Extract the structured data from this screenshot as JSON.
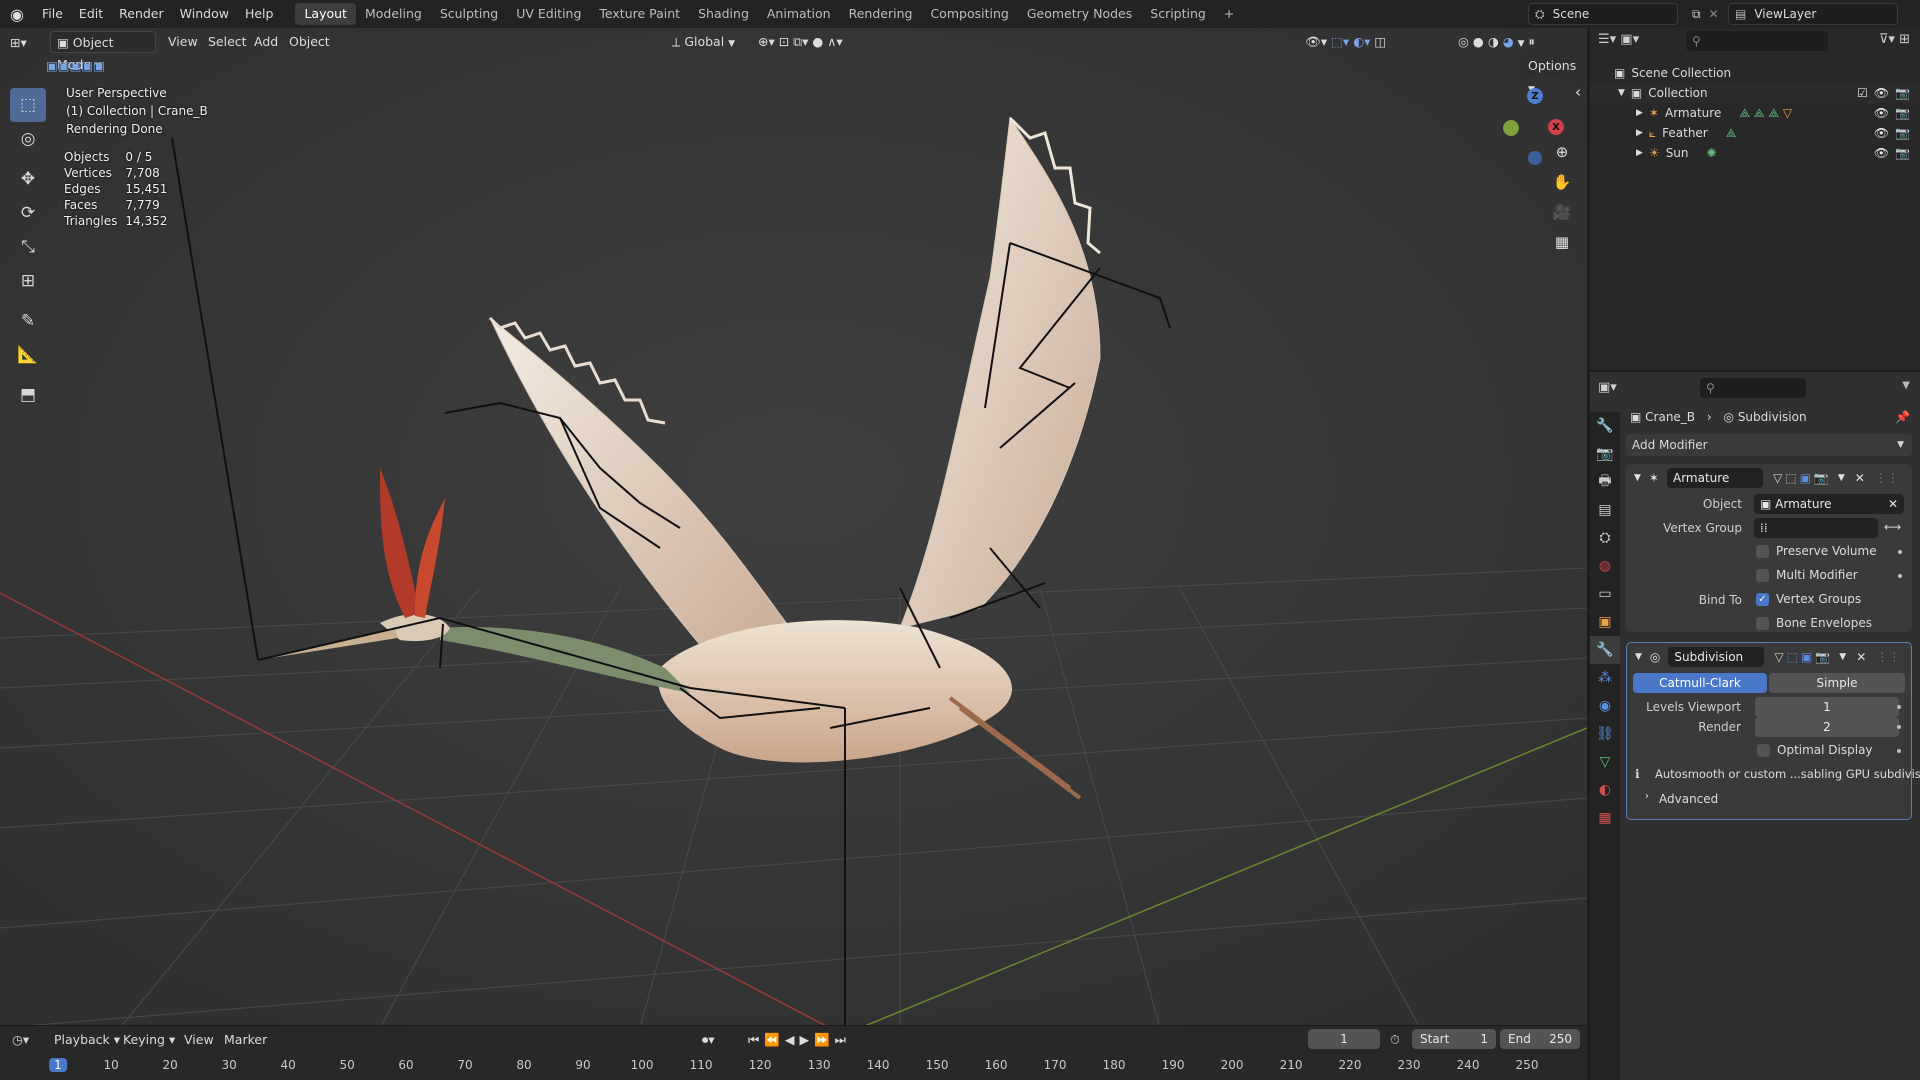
{
  "menu": {
    "items": [
      "File",
      "Edit",
      "Render",
      "Window",
      "Help"
    ],
    "workspaces": [
      "Layout",
      "Modeling",
      "Sculpting",
      "UV Editing",
      "Texture Paint",
      "Shading",
      "Animation",
      "Rendering",
      "Compositing",
      "Geometry Nodes",
      "Scripting"
    ],
    "active_workspace": "Layout",
    "add_tab": "+"
  },
  "scene": {
    "name": "Scene",
    "view_layer": "ViewLayer"
  },
  "viewport_header": {
    "mode": "Object Mode",
    "menus": [
      "View",
      "Select",
      "Add",
      "Object"
    ],
    "orientation": "Global",
    "options": "Options"
  },
  "overlay": {
    "perspective": "User Perspective",
    "collection_line": "(1) Collection | Crane_B",
    "render_status": "Rendering Done",
    "stats": [
      {
        "label": "Objects",
        "value": "0 / 5"
      },
      {
        "label": "Vertices",
        "value": "7,708"
      },
      {
        "label": "Edges",
        "value": "15,451"
      },
      {
        "label": "Faces",
        "value": "7,779"
      },
      {
        "label": "Triangles",
        "value": "14,352"
      }
    ]
  },
  "gizmo": {
    "z": "Z",
    "x": "X"
  },
  "timeline": {
    "menus": [
      "Playback",
      "Keying",
      "View",
      "Marker"
    ],
    "current_frame": "1",
    "start_label": "Start",
    "start": "1",
    "end_label": "End",
    "end": "250",
    "ticks": [
      "1",
      "10",
      "20",
      "30",
      "40",
      "50",
      "60",
      "70",
      "80",
      "90",
      "100",
      "110",
      "120",
      "130",
      "140",
      "150",
      "160",
      "170",
      "180",
      "190",
      "200",
      "210",
      "220",
      "230",
      "240",
      "250"
    ]
  },
  "outliner": {
    "root": "Scene Collection",
    "collection": "Collection",
    "items": [
      "Armature",
      "Feather",
      "Sun"
    ]
  },
  "properties": {
    "breadcrumb_object": "Crane_B",
    "breadcrumb_modifier": "Subdivision",
    "add_modifier": "Add Modifier",
    "armature": {
      "name": "Armature",
      "object_label": "Object",
      "object_value": "Armature",
      "vertex_group_label": "Vertex Group",
      "preserve_volume": "Preserve Volume",
      "multi_modifier": "Multi Modifier",
      "bind_to_label": "Bind To",
      "vertex_groups": "Vertex Groups",
      "bone_envelopes": "Bone Envelopes"
    },
    "subdivision": {
      "name": "Subdivision",
      "catmull": "Catmull-Clark",
      "simple": "Simple",
      "levels_viewport_label": "Levels Viewport",
      "levels_viewport": "1",
      "render_label": "Render",
      "render": "2",
      "optimal_display": "Optimal Display",
      "info": "Autosmooth or custom ...sabling GPU subdivision",
      "advanced": "Advanced"
    }
  }
}
